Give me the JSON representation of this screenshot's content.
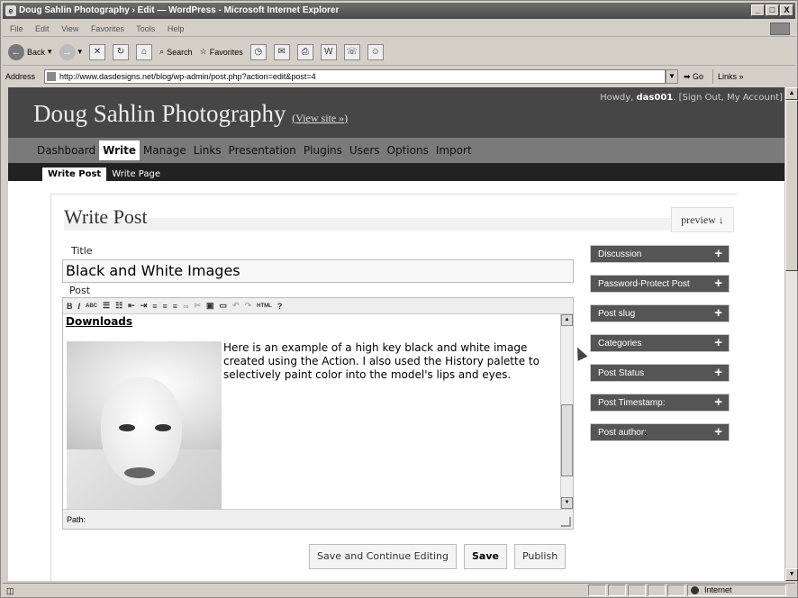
{
  "window": {
    "title": "Doug Sahlin Photography › Edit — WordPress - Microsoft Internet Explorer",
    "menu": [
      "File",
      "Edit",
      "View",
      "Favorites",
      "Tools",
      "Help"
    ],
    "controls": [
      "_",
      "□",
      "X"
    ]
  },
  "toolbar": {
    "back": "Back",
    "search": "Search",
    "favorites": "Favorites"
  },
  "address": {
    "label": "Address",
    "url": "http://www.dasdesigns.net/blog/wp-admin/post.php?action=edit&post=4",
    "go": "Go",
    "links": "Links »"
  },
  "status": {
    "left": "",
    "zone": "Internet"
  },
  "wp": {
    "site_name": "Doug Sahlin Photography",
    "view_site": "(View site »)",
    "howdy_prefix": "Howdy, ",
    "user": "das001",
    "howdy_suffix": ". [Sign Out, My Account]",
    "menu": [
      "Dashboard",
      "Write",
      "Manage",
      "Links",
      "Presentation",
      "Plugins",
      "Users",
      "Options",
      "Import"
    ],
    "submenu": [
      "Write Post",
      "Write Page"
    ],
    "heading": "Write Post",
    "preview": "preview ↓",
    "title_label": "Title",
    "title_value": "Black and White Images",
    "post_label": "Post",
    "editor_toolbar": [
      "B",
      "I",
      "ABC",
      "HTML"
    ],
    "downloads": "Downloads",
    "body": "Here is an example of a high key black and white image created using the Action. I also used the History palette to selectively paint color into the model's lips and eyes.",
    "path_label": "Path:",
    "buttons": {
      "save_continue": "Save and Continue Editing",
      "save": "Save",
      "publish": "Publish"
    },
    "sidebar": [
      "Discussion",
      "Password-Protect Post",
      "Post slug",
      "Categories",
      "Post Status",
      "Post Timestamp:",
      "Post author:"
    ]
  }
}
